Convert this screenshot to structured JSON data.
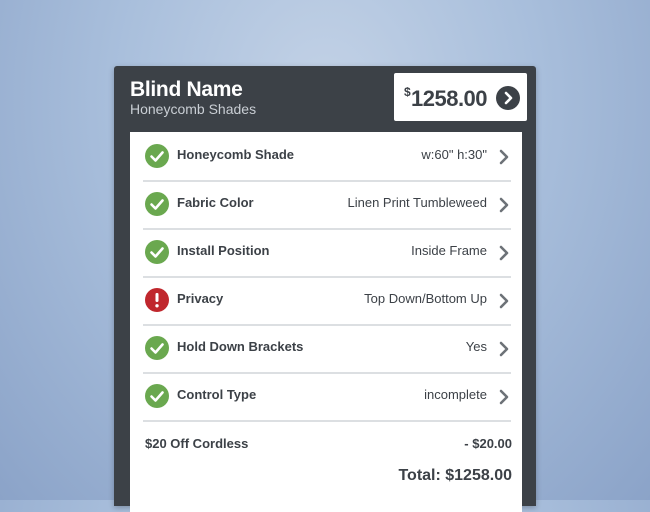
{
  "header": {
    "title": "Blind Name",
    "subtitle": "Honeycomb Shades",
    "price_symbol": "$",
    "price": "1258.00",
    "go_icon": "chevron-right-circle-icon"
  },
  "options": [
    {
      "label": "Honeycomb Shade",
      "value": "w:60\" h:30\"",
      "status": "complete",
      "status_icon": "check-circle-icon"
    },
    {
      "label": "Fabric Color",
      "value": "Linen Print Tumbleweed",
      "status": "complete",
      "status_icon": "check-circle-icon"
    },
    {
      "label": "Install Position",
      "value": "Inside Frame",
      "status": "complete",
      "status_icon": "check-circle-icon"
    },
    {
      "label": "Privacy",
      "value": "Top Down/Bottom Up",
      "status": "error",
      "status_icon": "alert-circle-icon"
    },
    {
      "label": "Hold Down Brackets",
      "value": "Yes",
      "status": "complete",
      "status_icon": "check-circle-icon"
    },
    {
      "label": "Control Type",
      "value": "incomplete",
      "status": "complete",
      "status_icon": "check-circle-icon"
    }
  ],
  "discount": {
    "label": "$20 Off Cordless",
    "amount": "- $20.00"
  },
  "total": "Total: $1258.00",
  "colors": {
    "header_bg": "#3c4147",
    "complete": "#6aa84f",
    "error": "#c0272d",
    "text": "#3c4147",
    "chevron": "#6d7278"
  }
}
